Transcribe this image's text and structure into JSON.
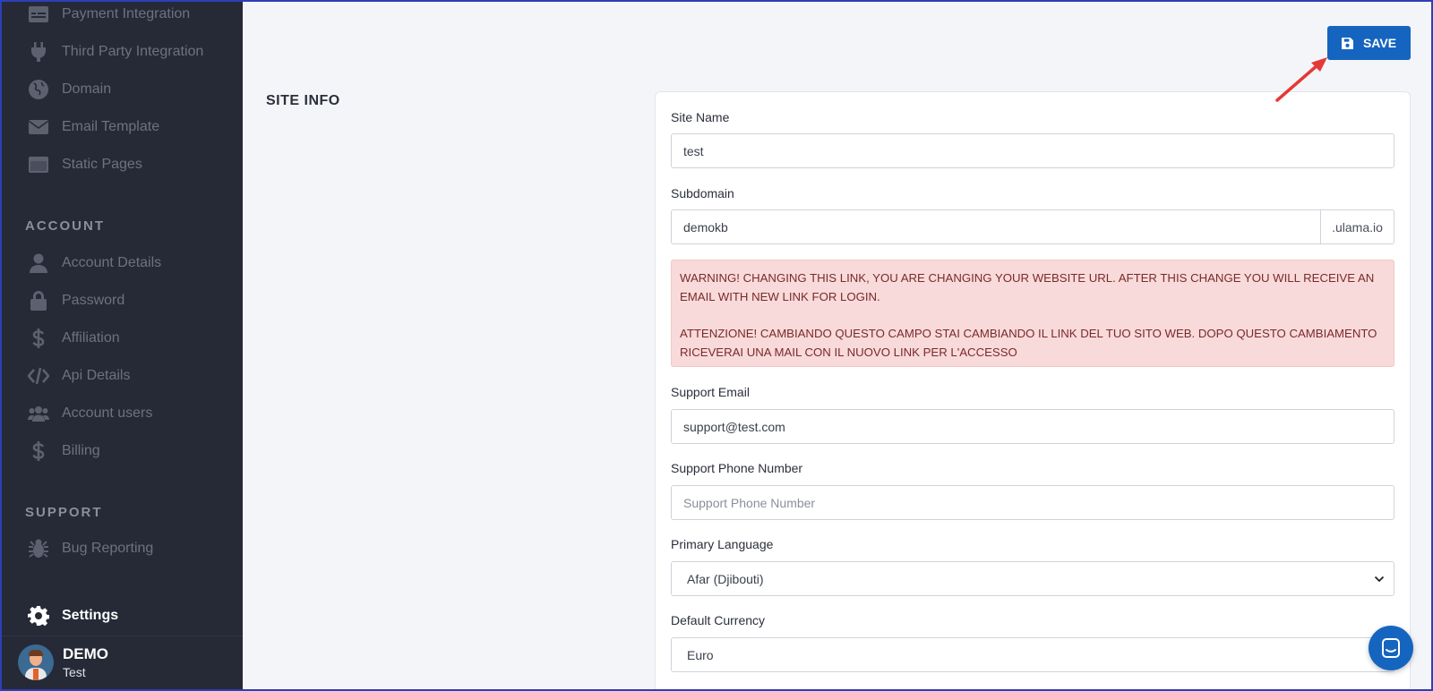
{
  "sidebar": {
    "top_items": [
      {
        "label": "Payment Integration",
        "icon": "payment-icon"
      },
      {
        "label": "Third Party Integration",
        "icon": "plug-icon"
      },
      {
        "label": "Domain",
        "icon": "globe-icon"
      },
      {
        "label": "Email Template",
        "icon": "envelope-icon"
      },
      {
        "label": "Static Pages",
        "icon": "window-icon"
      }
    ],
    "account_title": "ACCOUNT",
    "account_items": [
      {
        "label": "Account Details",
        "icon": "user-icon"
      },
      {
        "label": "Password",
        "icon": "lock-icon"
      },
      {
        "label": "Affiliation",
        "icon": "dollar-icon"
      },
      {
        "label": "Api Details",
        "icon": "code-icon"
      },
      {
        "label": "Account users",
        "icon": "users-icon"
      },
      {
        "label": "Billing",
        "icon": "dollar-icon"
      }
    ],
    "support_title": "SUPPORT",
    "support_items": [
      {
        "label": "Bug Reporting",
        "icon": "bug-icon"
      }
    ],
    "active_item": {
      "label": "Settings",
      "icon": "gear-icon"
    },
    "user": {
      "name": "DEMO",
      "subtitle": "Test"
    }
  },
  "toolbar": {
    "save_label": "SAVE"
  },
  "section": {
    "heading": "SITE INFO"
  },
  "form": {
    "site_name": {
      "label": "Site Name",
      "value": "test"
    },
    "subdomain": {
      "label": "Subdomain",
      "value": "demokb",
      "suffix": ".ulama.io"
    },
    "warning": {
      "en": "WARNING! CHANGING THIS LINK, YOU ARE CHANGING YOUR WEBSITE URL. AFTER THIS CHANGE YOU WILL RECEIVE AN EMAIL WITH NEW LINK FOR LOGIN.",
      "it": "ATTENZIONE! CAMBIANDO QUESTO CAMPO STAI CAMBIANDO IL LINK DEL TUO SITO WEB. DOPO QUESTO CAMBIAMENTO RICEVERAI UNA MAIL CON IL NUOVO LINK PER L'ACCESSO"
    },
    "support_email": {
      "label": "Support Email",
      "value": "support@test.com"
    },
    "support_phone": {
      "label": "Support Phone Number",
      "value": "",
      "placeholder": "Support Phone Number"
    },
    "primary_language": {
      "label": "Primary Language",
      "value": "Afar (Djibouti)"
    },
    "default_currency": {
      "label": "Default Currency",
      "value": "Euro"
    }
  },
  "colors": {
    "sidebar_bg": "#252a36",
    "accent": "#1565c0",
    "warning_bg": "#f8dada",
    "page_bg": "#f4f5f9",
    "annotation_arrow": "#e53935"
  }
}
